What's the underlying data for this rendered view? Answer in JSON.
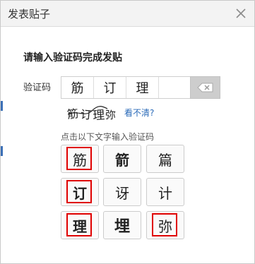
{
  "dialog": {
    "title": "发表贴子",
    "heading": "请输入验证码完成发贴",
    "captcha_label": "验证码",
    "entered_chars": [
      "筋",
      "订",
      "理"
    ],
    "captcha_image": {
      "chars": [
        "筋",
        "订",
        "理",
        "弥"
      ]
    },
    "refresh_link": "看不清?",
    "instruction": "点击以下文字输入验证码",
    "options": [
      {
        "char": "筋",
        "selected": true
      },
      {
        "char": "箭",
        "selected": false
      },
      {
        "char": "篇",
        "selected": false
      },
      {
        "char": "订",
        "selected": true
      },
      {
        "char": "讶",
        "selected": false
      },
      {
        "char": "计",
        "selected": false
      },
      {
        "char": "理",
        "selected": true
      },
      {
        "char": "埋",
        "selected": false
      },
      {
        "char": "弥",
        "selected": true
      }
    ],
    "accent_color": "#e00000",
    "link_color": "#2a6ab8"
  }
}
